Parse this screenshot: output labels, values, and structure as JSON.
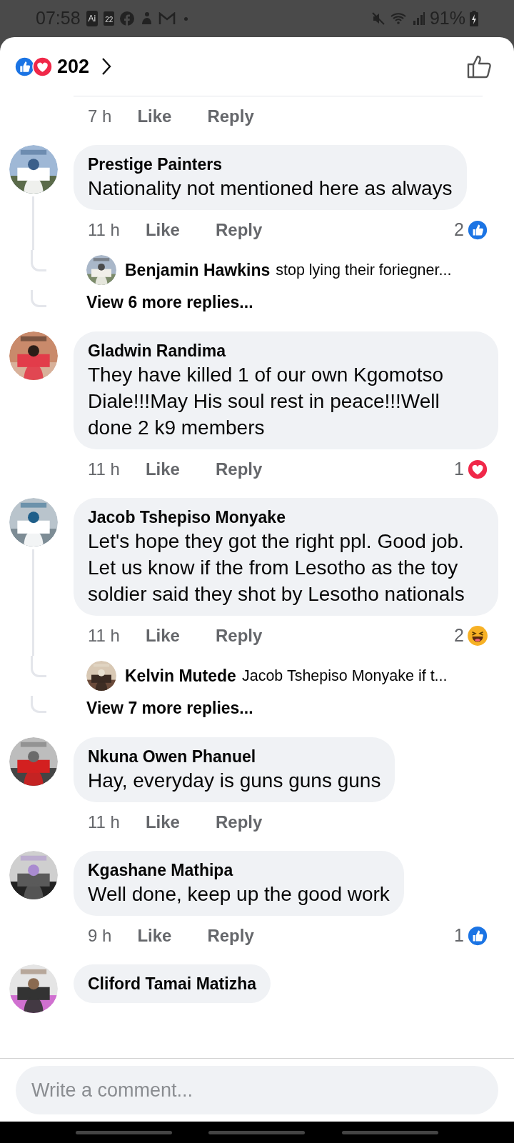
{
  "status_bar": {
    "time": "07:58",
    "app_label": "Ai",
    "calendar_day": "22",
    "battery": "91%"
  },
  "header": {
    "reactions": [
      {
        "kind": "like"
      },
      {
        "kind": "love"
      }
    ],
    "count": "202"
  },
  "previous_meta": {
    "time": "7 h",
    "like": "Like",
    "reply": "Reply"
  },
  "comments": [
    {
      "name": "Prestige Painters",
      "text": "Nationality not mentioned here as always",
      "time": "11 h",
      "like": "Like",
      "reply": "Reply",
      "reaction": {
        "count": "2",
        "kind": "like"
      },
      "replies": [
        {
          "name": "Benjamin Hawkins",
          "text": "stop lying their foriegner..."
        }
      ],
      "view_more": "View 6 more replies..."
    },
    {
      "name": "Gladwin Randima",
      "text": "They have killed 1 of our own Kgomotso Diale!!!May His soul rest in peace!!!Well done 2 k9 members",
      "time": "11 h",
      "like": "Like",
      "reply": "Reply",
      "reaction": {
        "count": "1",
        "kind": "love"
      }
    },
    {
      "name": "Jacob Tshepiso Monyake",
      "text": "Let's hope they got the right ppl. Good job. Let us know if the from Lesotho as the toy soldier said they shot by Lesotho nationals",
      "time": "11 h",
      "like": "Like",
      "reply": "Reply",
      "reaction": {
        "count": "2",
        "kind": "haha"
      },
      "replies": [
        {
          "name": "Kelvin Mutede",
          "text": "Jacob Tshepiso Monyake if t..."
        }
      ],
      "view_more": "View 7 more replies..."
    },
    {
      "name": "Nkuna Owen Phanuel",
      "text": "Hay, everyday is guns guns guns",
      "time": "11 h",
      "like": "Like",
      "reply": "Reply"
    },
    {
      "name": "Kgashane Mathipa",
      "text": "Well done, keep up the good work",
      "time": "9 h",
      "like": "Like",
      "reply": "Reply",
      "reaction": {
        "count": "1",
        "kind": "like"
      }
    },
    {
      "name": "Cliford Tamai Matizha"
    }
  ],
  "composer": {
    "placeholder": "Write a comment..."
  }
}
